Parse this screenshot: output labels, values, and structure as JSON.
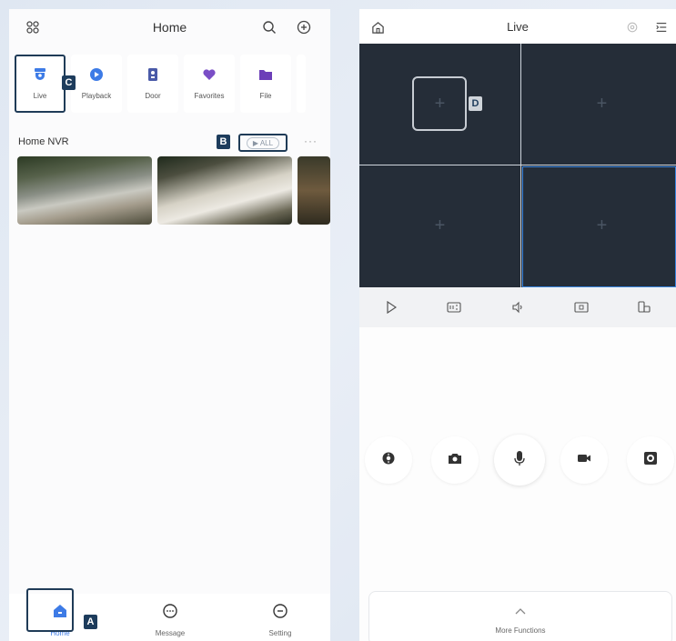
{
  "left": {
    "header": {
      "title": "Home"
    },
    "quick_items": [
      {
        "label": "Live",
        "icon": "camera-icon",
        "color": "#3d7be6"
      },
      {
        "label": "Playback",
        "icon": "playback-icon",
        "color": "#3d7be6"
      },
      {
        "label": "Door",
        "icon": "door-icon",
        "color": "#4a5aa8"
      },
      {
        "label": "Favorites",
        "icon": "heart-icon",
        "color": "#7a4ec6"
      },
      {
        "label": "File",
        "icon": "folder-icon",
        "color": "#6c3fb8"
      }
    ],
    "device": {
      "name": "Home NVR",
      "all_label": "▶ ALL",
      "more": "···"
    },
    "nav": [
      {
        "label": "Home",
        "icon": "home-icon",
        "color": "#3d7be6"
      },
      {
        "label": "Message",
        "icon": "message-icon",
        "color": "#333333"
      },
      {
        "label": "Setting",
        "icon": "settings-icon",
        "color": "#333333"
      }
    ],
    "badges": {
      "a": "A",
      "b": "B",
      "c": "C"
    }
  },
  "right": {
    "header": {
      "title": "Live"
    },
    "badge_d": "D",
    "cell_plus": "+",
    "more_functions": {
      "label": "More Functions",
      "chevron": "^"
    }
  },
  "colors": {
    "accent": "#3d7be6",
    "highlight_border": "#1f3b57",
    "grid_bg": "#252d38"
  }
}
